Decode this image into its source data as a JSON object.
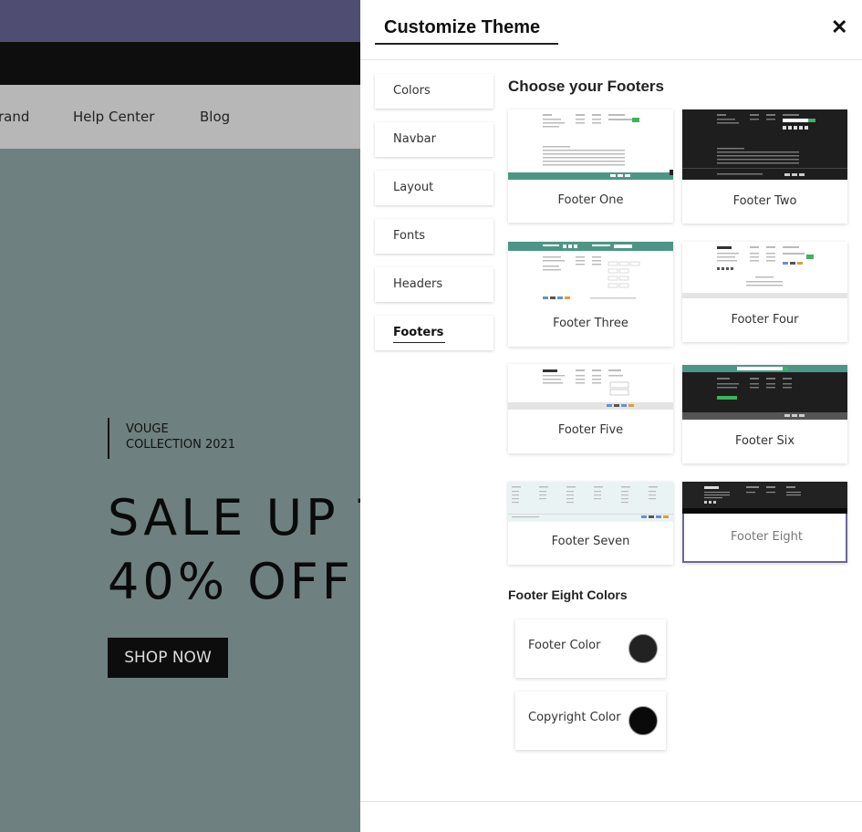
{
  "site": {
    "nav": [
      "rand",
      "Help Center",
      "Blog"
    ],
    "tagline_line1": "VOUGE",
    "tagline_line2": "COLLECTION 2021",
    "headline_line1": "SALE UP T",
    "headline_line2": "40% OFF",
    "cta": "SHOP NOW",
    "colors": {
      "topbar": "#4f4e72",
      "hero": "#6f8080"
    }
  },
  "panel": {
    "title": "Customize Theme",
    "close_icon": "close-icon",
    "tabs": [
      {
        "label": "Colors"
      },
      {
        "label": "Navbar"
      },
      {
        "label": "Layout"
      },
      {
        "label": "Fonts"
      },
      {
        "label": "Headers"
      },
      {
        "label": "Footers",
        "active": true
      }
    ],
    "section_title": "Choose your Footers",
    "footers": [
      {
        "label": "Footer One",
        "theme": "light"
      },
      {
        "label": "Footer Two",
        "theme": "dark"
      },
      {
        "label": "Footer Three",
        "theme": "light"
      },
      {
        "label": "Footer Four",
        "theme": "light"
      },
      {
        "label": "Footer Five",
        "theme": "light"
      },
      {
        "label": "Footer Six",
        "theme": "dark"
      },
      {
        "label": "Footer Seven",
        "theme": "pale"
      },
      {
        "label": "Footer Eight",
        "theme": "dark",
        "selected": true
      }
    ],
    "colors_title": "Footer Eight Colors",
    "color_options": [
      {
        "label": "Footer Color",
        "value": "#222222"
      },
      {
        "label": "Copyright Color",
        "value": "#0a0a0a"
      }
    ],
    "accent": "#6a6896"
  }
}
